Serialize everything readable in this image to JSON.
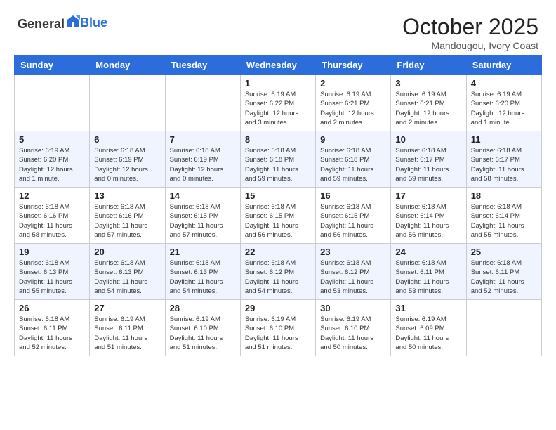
{
  "header": {
    "logo_general": "General",
    "logo_blue": "Blue",
    "month": "October 2025",
    "location": "Mandougou, Ivory Coast"
  },
  "weekdays": [
    "Sunday",
    "Monday",
    "Tuesday",
    "Wednesday",
    "Thursday",
    "Friday",
    "Saturday"
  ],
  "weeks": [
    {
      "row_bg": "normal",
      "days": [
        {
          "num": "",
          "info": ""
        },
        {
          "num": "",
          "info": ""
        },
        {
          "num": "",
          "info": ""
        },
        {
          "num": "1",
          "info": "Sunrise: 6:19 AM\nSunset: 6:22 PM\nDaylight: 12 hours and 3 minutes."
        },
        {
          "num": "2",
          "info": "Sunrise: 6:19 AM\nSunset: 6:21 PM\nDaylight: 12 hours and 2 minutes."
        },
        {
          "num": "3",
          "info": "Sunrise: 6:19 AM\nSunset: 6:21 PM\nDaylight: 12 hours and 2 minutes."
        },
        {
          "num": "4",
          "info": "Sunrise: 6:19 AM\nSunset: 6:20 PM\nDaylight: 12 hours and 1 minute."
        }
      ]
    },
    {
      "row_bg": "alt",
      "days": [
        {
          "num": "5",
          "info": "Sunrise: 6:19 AM\nSunset: 6:20 PM\nDaylight: 12 hours and 1 minute."
        },
        {
          "num": "6",
          "info": "Sunrise: 6:18 AM\nSunset: 6:19 PM\nDaylight: 12 hours and 0 minutes."
        },
        {
          "num": "7",
          "info": "Sunrise: 6:18 AM\nSunset: 6:19 PM\nDaylight: 12 hours and 0 minutes."
        },
        {
          "num": "8",
          "info": "Sunrise: 6:18 AM\nSunset: 6:18 PM\nDaylight: 11 hours and 59 minutes."
        },
        {
          "num": "9",
          "info": "Sunrise: 6:18 AM\nSunset: 6:18 PM\nDaylight: 11 hours and 59 minutes."
        },
        {
          "num": "10",
          "info": "Sunrise: 6:18 AM\nSunset: 6:17 PM\nDaylight: 11 hours and 59 minutes."
        },
        {
          "num": "11",
          "info": "Sunrise: 6:18 AM\nSunset: 6:17 PM\nDaylight: 11 hours and 58 minutes."
        }
      ]
    },
    {
      "row_bg": "normal",
      "days": [
        {
          "num": "12",
          "info": "Sunrise: 6:18 AM\nSunset: 6:16 PM\nDaylight: 11 hours and 58 minutes."
        },
        {
          "num": "13",
          "info": "Sunrise: 6:18 AM\nSunset: 6:16 PM\nDaylight: 11 hours and 57 minutes."
        },
        {
          "num": "14",
          "info": "Sunrise: 6:18 AM\nSunset: 6:15 PM\nDaylight: 11 hours and 57 minutes."
        },
        {
          "num": "15",
          "info": "Sunrise: 6:18 AM\nSunset: 6:15 PM\nDaylight: 11 hours and 56 minutes."
        },
        {
          "num": "16",
          "info": "Sunrise: 6:18 AM\nSunset: 6:15 PM\nDaylight: 11 hours and 56 minutes."
        },
        {
          "num": "17",
          "info": "Sunrise: 6:18 AM\nSunset: 6:14 PM\nDaylight: 11 hours and 56 minutes."
        },
        {
          "num": "18",
          "info": "Sunrise: 6:18 AM\nSunset: 6:14 PM\nDaylight: 11 hours and 55 minutes."
        }
      ]
    },
    {
      "row_bg": "alt",
      "days": [
        {
          "num": "19",
          "info": "Sunrise: 6:18 AM\nSunset: 6:13 PM\nDaylight: 11 hours and 55 minutes."
        },
        {
          "num": "20",
          "info": "Sunrise: 6:18 AM\nSunset: 6:13 PM\nDaylight: 11 hours and 54 minutes."
        },
        {
          "num": "21",
          "info": "Sunrise: 6:18 AM\nSunset: 6:13 PM\nDaylight: 11 hours and 54 minutes."
        },
        {
          "num": "22",
          "info": "Sunrise: 6:18 AM\nSunset: 6:12 PM\nDaylight: 11 hours and 54 minutes."
        },
        {
          "num": "23",
          "info": "Sunrise: 6:18 AM\nSunset: 6:12 PM\nDaylight: 11 hours and 53 minutes."
        },
        {
          "num": "24",
          "info": "Sunrise: 6:18 AM\nSunset: 6:11 PM\nDaylight: 11 hours and 53 minutes."
        },
        {
          "num": "25",
          "info": "Sunrise: 6:18 AM\nSunset: 6:11 PM\nDaylight: 11 hours and 52 minutes."
        }
      ]
    },
    {
      "row_bg": "normal",
      "days": [
        {
          "num": "26",
          "info": "Sunrise: 6:18 AM\nSunset: 6:11 PM\nDaylight: 11 hours and 52 minutes."
        },
        {
          "num": "27",
          "info": "Sunrise: 6:19 AM\nSunset: 6:11 PM\nDaylight: 11 hours and 51 minutes."
        },
        {
          "num": "28",
          "info": "Sunrise: 6:19 AM\nSunset: 6:10 PM\nDaylight: 11 hours and 51 minutes."
        },
        {
          "num": "29",
          "info": "Sunrise: 6:19 AM\nSunset: 6:10 PM\nDaylight: 11 hours and 51 minutes."
        },
        {
          "num": "30",
          "info": "Sunrise: 6:19 AM\nSunset: 6:10 PM\nDaylight: 11 hours and 50 minutes."
        },
        {
          "num": "31",
          "info": "Sunrise: 6:19 AM\nSunset: 6:09 PM\nDaylight: 11 hours and 50 minutes."
        },
        {
          "num": "",
          "info": ""
        }
      ]
    }
  ]
}
